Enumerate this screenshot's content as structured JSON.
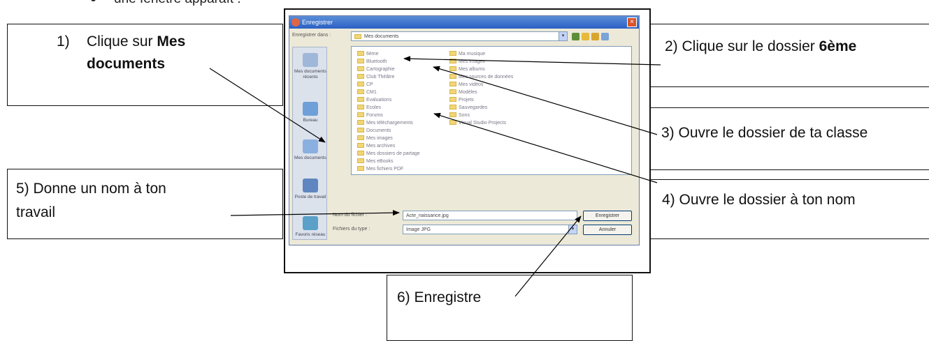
{
  "intro": {
    "bullet_text": "une fenêtre apparaît :"
  },
  "callouts": {
    "step1": {
      "prefix": "1)",
      "text_before": "Clique sur ",
      "bold_1": "Mes",
      "bold_2": "documents"
    },
    "step2": {
      "text_before": "2) Clique sur le dossier ",
      "bold": "6ème"
    },
    "step3": {
      "text": "3) Ouvre le dossier de ta classe"
    },
    "step4": {
      "text": "4) Ouvre le dossier à ton nom"
    },
    "step5": {
      "line1": "5) Donne un nom à ton",
      "line2": "travail"
    },
    "step6": {
      "text": "6) Enregistre"
    }
  },
  "dialog": {
    "title": "Enregistrer",
    "close_glyph": "×",
    "save_in_label": "Enregistrer dans :",
    "save_in_value": "Mes documents",
    "places": [
      {
        "label": "Mes documents récents",
        "icon": "recent-documents-icon",
        "color": "#9fb7d9"
      },
      {
        "label": "Bureau",
        "icon": "desktop-icon",
        "color": "#6f9fd8"
      },
      {
        "label": "Mes documents",
        "icon": "my-documents-icon",
        "color": "#8ab0e0"
      },
      {
        "label": "Poste de travail",
        "icon": "my-computer-icon",
        "color": "#5f86c0"
      },
      {
        "label": "Favoris réseau",
        "icon": "network-places-icon",
        "color": "#5aa0c8"
      }
    ],
    "files_col1": [
      "6ème",
      "Bluetooth",
      "Cartographie",
      "Club Théâtre",
      "CP",
      "CM1",
      "Evaluations",
      "Ecoles",
      "Forums",
      "Mes téléchargements",
      "Documents",
      "Mes images",
      "Mes archives",
      "Mes dossiers de partage",
      "Mes eBooks",
      "Mes fichiers PDF"
    ],
    "files_col2": [
      "Ma musique",
      "Mes images",
      "Mes albums",
      "Mes sources de données",
      "Mes vidéos",
      "Modèles",
      "Projets",
      "Sauvegardes",
      "Sons",
      "Visual Studio Projects"
    ],
    "filename_label": "Nom du fichier :",
    "filename_value": "Acte_naissance.jpg",
    "filetype_label": "Fichiers du type :",
    "filetype_value": "Image JPG",
    "save_button": "Enregistrer",
    "cancel_button": "Annuler",
    "combo_arrow": "▾"
  },
  "colors": {
    "titlebar": "#2a5fc4",
    "dialog_bg": "#ece9d8",
    "folder": "#f2d675"
  }
}
